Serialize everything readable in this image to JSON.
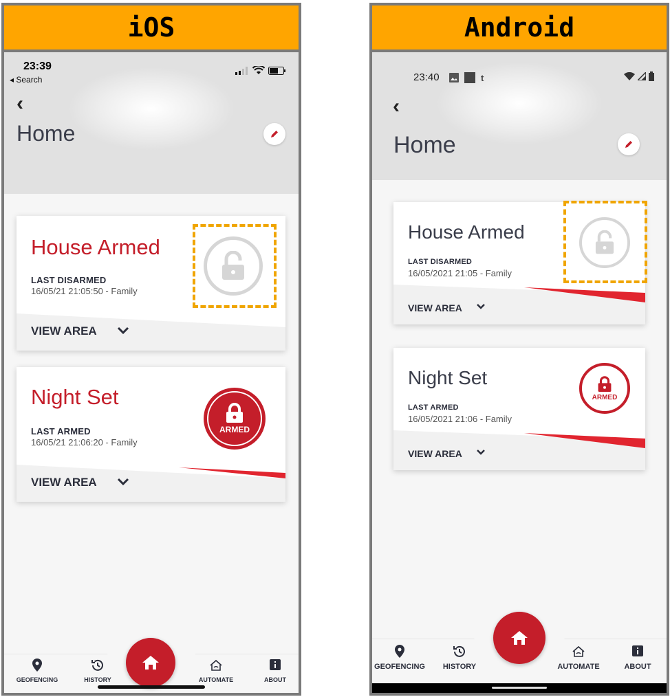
{
  "labels": {
    "ios": "iOS",
    "android": "Android"
  },
  "ios": {
    "status": {
      "time": "23:39",
      "back_app": "◂ Search"
    },
    "header": {
      "title": "Home"
    },
    "cards": [
      {
        "name": "House Armed",
        "sub_label": "LAST DISARMED",
        "date": "16/05/21 21:05:50 - Family",
        "view_area": "VIEW AREA",
        "state": "disarmed"
      },
      {
        "name": "Night Set",
        "sub_label": "LAST ARMED",
        "date": "16/05/21 21:06:20 - Family",
        "view_area": "VIEW AREA",
        "state": "armed",
        "badge": "ARMED"
      }
    ],
    "nav": {
      "geofencing": "GEOFENCING",
      "history": "HISTORY",
      "automate": "AUTOMATE",
      "about": "ABOUT"
    }
  },
  "android": {
    "status": {
      "time": "23:40",
      "notif_letter": "t"
    },
    "header": {
      "title": "Home"
    },
    "cards": [
      {
        "name": "House Armed",
        "sub_label": "LAST DISARMED",
        "date": "16/05/2021 21:05 - Family",
        "view_area": "VIEW AREA",
        "state": "disarmed"
      },
      {
        "name": "Night Set",
        "sub_label": "LAST ARMED",
        "date": "16/05/2021 21:06 - Family",
        "view_area": "VIEW AREA",
        "state": "armed",
        "badge": "ARMED"
      }
    ],
    "nav": {
      "geofencing": "GEOFENCING",
      "history": "HISTORY",
      "automate": "AUTOMATE",
      "about": "ABOUT"
    }
  },
  "colors": {
    "brand_red": "#c41e2a",
    "highlight_orange": "#ffa500",
    "disarmed_grey": "#cfcfcf"
  }
}
